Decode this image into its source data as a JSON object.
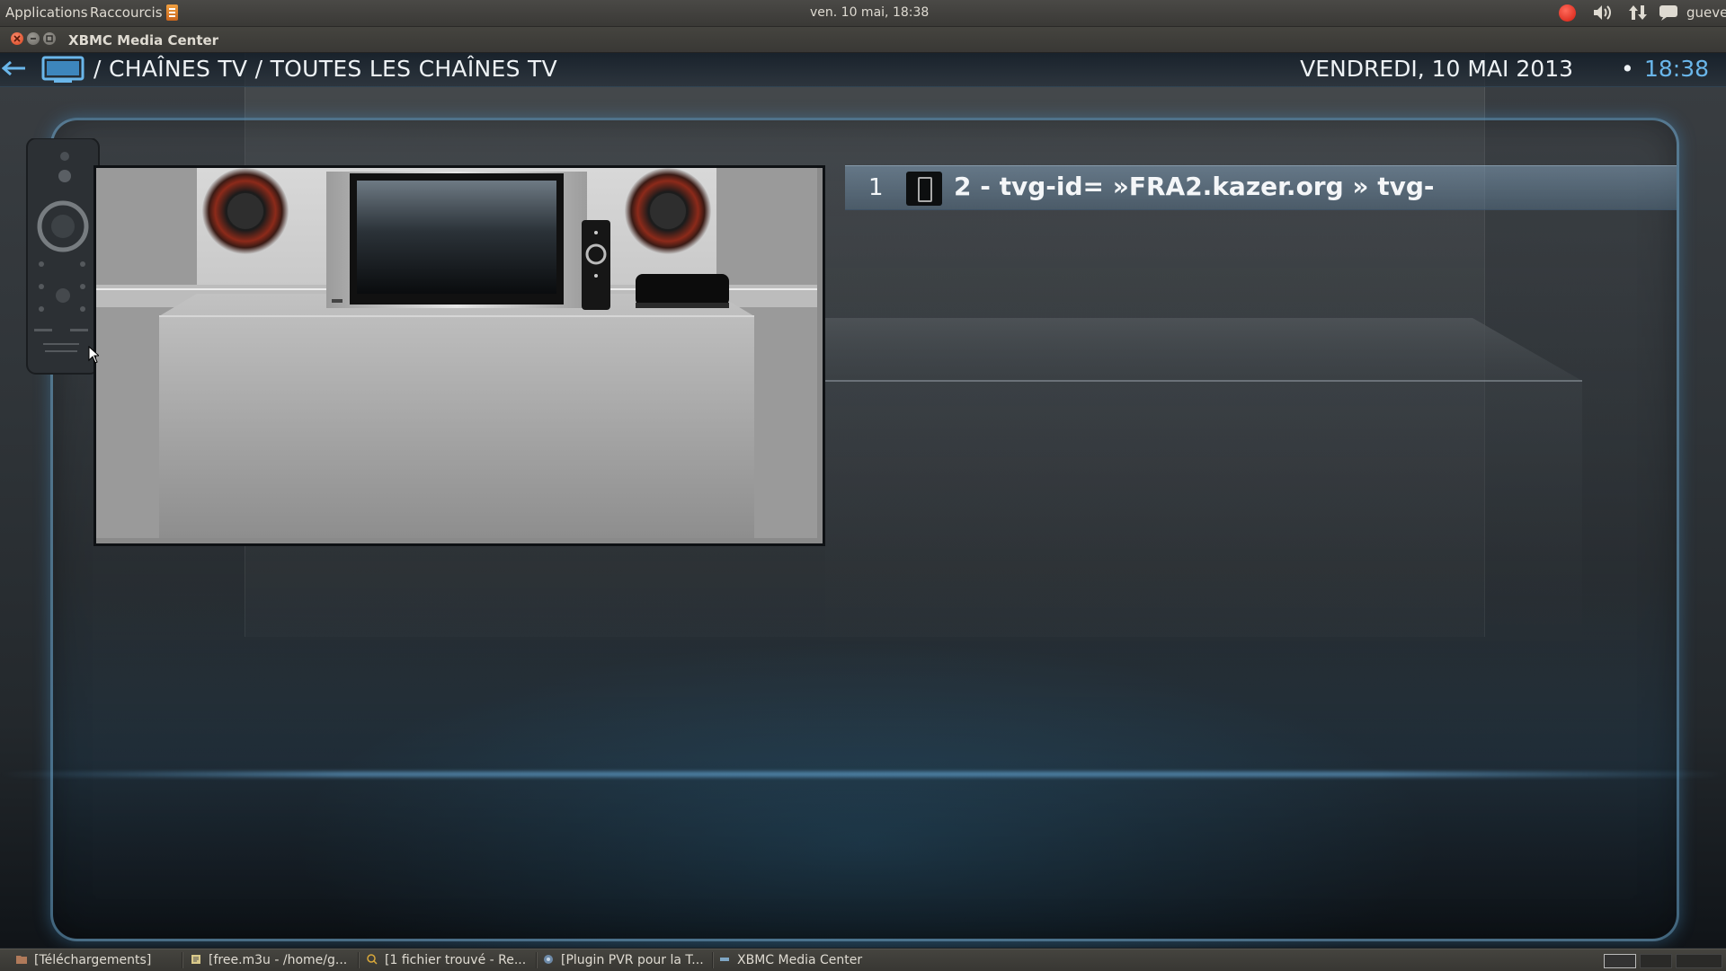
{
  "top_panel": {
    "applications_label": "Applications",
    "shortcuts_label": "Raccourcis",
    "clock": "ven. 10 mai, 18:38",
    "user": "guevel"
  },
  "window": {
    "title": "XBMC Media Center"
  },
  "xbmc": {
    "breadcrumb": "/ CHAÎNES TV / TOUTES LES CHAÎNES TV",
    "date": "VENDREDI, 10 MAI 2013",
    "separator": "•",
    "time": "18:38",
    "accent_color": "#6ab6ea",
    "channels": [
      {
        "number": "1",
        "name": "2 - tvg-id= »FRA2.kazer.org » tvg-"
      }
    ]
  },
  "taskbar": {
    "tasks": [
      {
        "label": "[Téléchargements]",
        "icon": "folder-icon"
      },
      {
        "label": "[free.m3u - /home/g...",
        "icon": "text-editor-icon"
      },
      {
        "label": "[1 fichier trouvé - Re...",
        "icon": "search-icon"
      },
      {
        "label": "[Plugin PVR pour la T...",
        "icon": "browser-icon"
      },
      {
        "label": "XBMC Media Center",
        "icon": "xbmc-icon"
      }
    ]
  }
}
